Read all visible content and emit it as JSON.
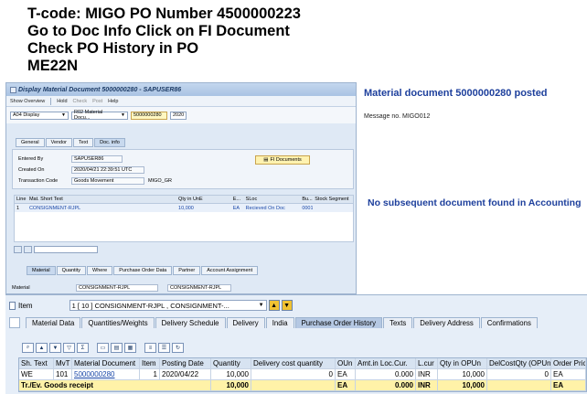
{
  "caption": {
    "line1": "T-code: MIGO PO Number 4500000223",
    "line2": "Go to Doc Info Click on FI Document",
    "line3": "Check PO History in PO",
    "line4": "ME22N"
  },
  "migo": {
    "title": "Display Material Document 5000000280 - SAPUSER86",
    "toolbar": {
      "show_overview": "Show Overview",
      "hold": "Hold",
      "check": "Check",
      "post": "Post",
      "help": "Help"
    },
    "action": "A04 Display",
    "ref_doc": "R02 Material Docu...",
    "doc_number": "5000000280",
    "year": "2020",
    "tabs": [
      "General",
      "Vendor",
      "Text",
      "Doc. info"
    ],
    "doc_info": {
      "entered_by_label": "Entered By",
      "entered_by": "SAPUSER86",
      "created_on_label": "Created On",
      "created_on": "2020/04/21 22:39:51 UTC",
      "transaction_code_label": "Transaction Code",
      "transaction_code": "Goods Movement",
      "transaction_code_value": "MIGO_GR",
      "fi_documents_button": "FI Documents"
    },
    "item_grid": {
      "headers": [
        "Line",
        "Mat. Short Text",
        "",
        "Qty in UnE",
        "E...",
        "SLoc",
        "Bu...",
        "Stock Segment"
      ],
      "rows": [
        [
          "1",
          "CONSIGNMENT-RJPL",
          "",
          "10,000",
          "EA",
          "Recieved On Doc",
          "0001",
          ""
        ]
      ]
    },
    "detail_tabs": [
      "Material",
      "Quantity",
      "Where",
      "Purchase Order Data",
      "Partner",
      "Account Assignment"
    ],
    "material_label": "Material",
    "material_value_1": "CONSIGNMENT-RJPL",
    "material_value_2": "CONSIGNMENT-RJPL"
  },
  "messages": {
    "posted": "Material document 5000000280 posted",
    "msg_no": "Message no. MIGO012",
    "no_subsequent": "No subsequent document found in Accounting"
  },
  "po": {
    "item_label": "Item",
    "item_value": "1 [ 10 ] CONSIGNMENT-RJPL , CONSIGNMENT-...",
    "tabs": [
      "Material Data",
      "Quantities/Weights",
      "Delivery Schedule",
      "Delivery",
      "India",
      "Purchase Order History",
      "Texts",
      "Delivery Address",
      "Confirmations"
    ],
    "active_tab": "Purchase Order History",
    "history": {
      "headers": [
        "Sh. Text",
        "MvT",
        "Material Document",
        "Item",
        "Posting Date",
        "Quantity",
        "Delivery cost quantity",
        "OUn",
        "Amt.in Loc.Cur.",
        "L.cur",
        "Qty in OPUn",
        "DelCostQty (OPUn)",
        "Order Pric"
      ],
      "rows": [
        [
          "WE",
          "101",
          "5000000280",
          "1",
          "2020/04/22",
          "10,000",
          "0",
          "EA",
          "0.000",
          "INR",
          "10,000",
          "0",
          "EA"
        ]
      ],
      "total": [
        "Tr./Ev. Goods receipt",
        "",
        "",
        "",
        "",
        "10,000",
        "",
        "EA",
        "0.000",
        "INR",
        "10,000",
        "",
        "EA"
      ]
    }
  }
}
